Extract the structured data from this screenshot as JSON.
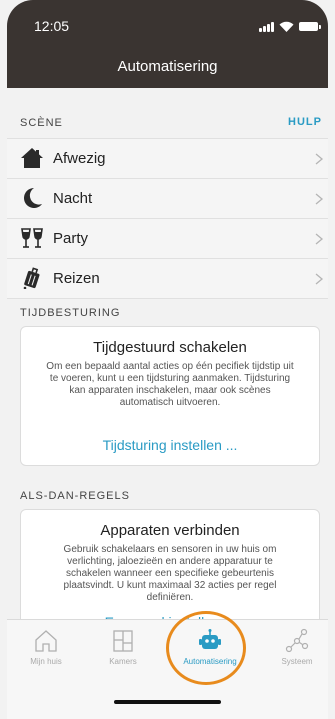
{
  "status": {
    "time": "12:05"
  },
  "header": {
    "title": "Automatisering"
  },
  "scene": {
    "heading": "SCÈNE",
    "help": "HULP",
    "items": [
      {
        "label": "Afwezig",
        "icon": "home-icon"
      },
      {
        "label": "Nacht",
        "icon": "moon-icon"
      },
      {
        "label": "Party",
        "icon": "glasses-icon"
      },
      {
        "label": "Reizen",
        "icon": "suitcase-icon"
      }
    ]
  },
  "timing": {
    "heading": "TIJDBESTURING",
    "title": "Tijdgestuurd schakelen",
    "description": "Om een bepaald aantal acties op één pecifiek tijdstip uit te voeren, kunt u een tijdsturing aanmaken. Tijdsturing kan apparaten inschakelen, maar ook scènes automatisch uitvoeren.",
    "link": "Tijdsturing instellen ..."
  },
  "rules": {
    "heading": "ALS-DAN-REGELS",
    "title": "Apparaten verbinden",
    "description": "Gebruik schakelaars en sensoren in uw huis om verlichting, jaloezieën en andere apparatuur te schakelen wanneer een specifieke gebeurtenis plaatsvindt. U kunt maximaal 32 acties per regel definiëren.",
    "link": "Een regel instellen ..."
  },
  "tabs": [
    {
      "label": "Mijn huis",
      "icon": "house-outline-icon",
      "active": false
    },
    {
      "label": "Kamers",
      "icon": "rooms-icon",
      "active": false
    },
    {
      "label": "Automatisering",
      "icon": "robot-icon",
      "active": true
    },
    {
      "label": "Systeem",
      "icon": "network-icon",
      "active": false
    }
  ],
  "colors": {
    "header": "#3a3431",
    "accent": "#2a9bc4",
    "highlight": "#e88b1d"
  }
}
